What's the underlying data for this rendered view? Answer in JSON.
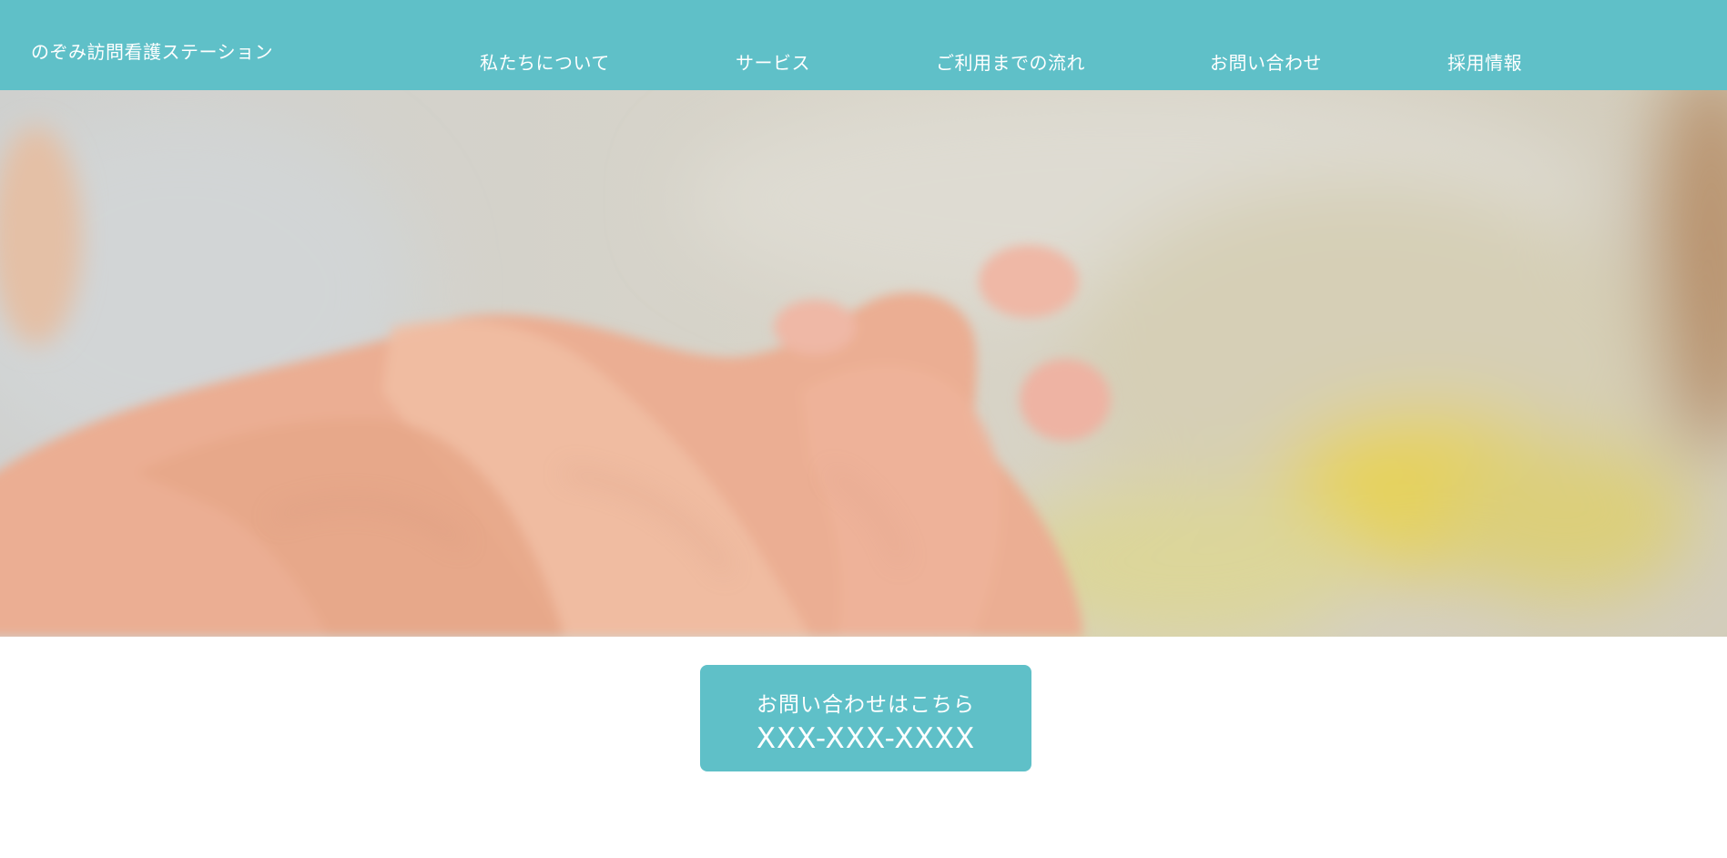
{
  "header": {
    "site_title": "のぞみ訪問看護ステーション",
    "nav": [
      {
        "label": "私たちについて"
      },
      {
        "label": "サービス"
      },
      {
        "label": "ご利用までの流れ"
      },
      {
        "label": "お問い合わせ"
      },
      {
        "label": "採用情報"
      }
    ]
  },
  "contact": {
    "label": "お問い合わせはこちら",
    "phone": "XXX-XXX-XXXX"
  },
  "colors": {
    "accent": "#5fc0c8",
    "text_on_accent": "#ffffff"
  }
}
